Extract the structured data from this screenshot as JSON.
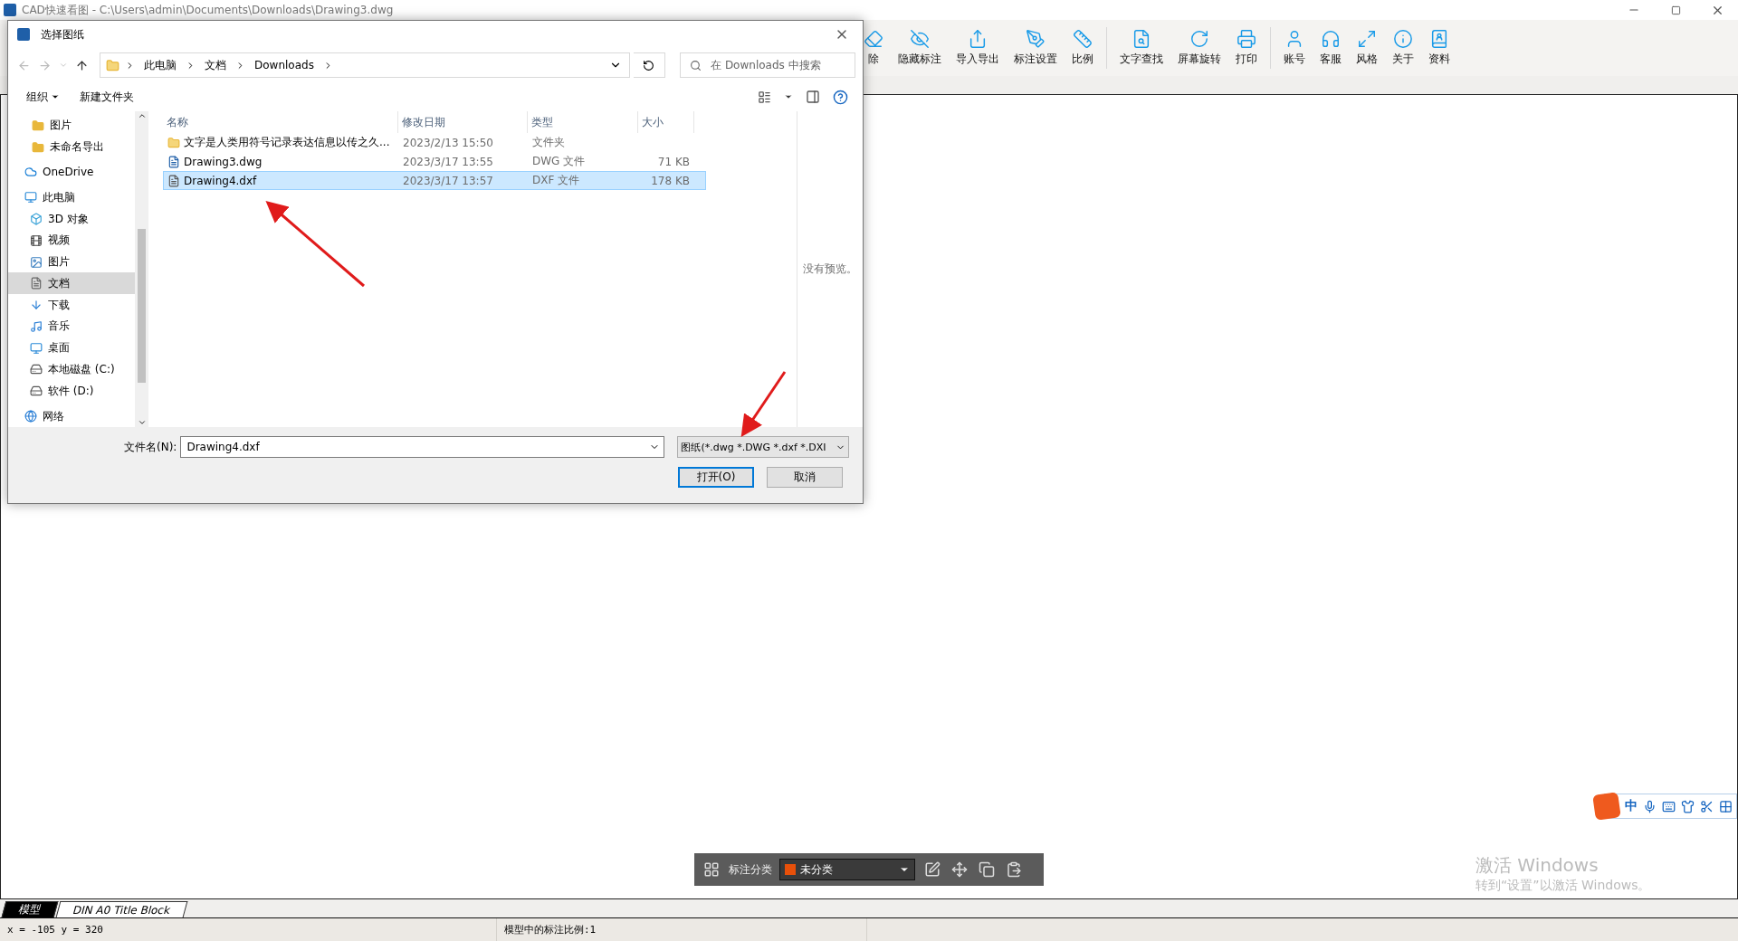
{
  "app": {
    "title": "CAD快速看图 - C:\\Users\\admin\\Documents\\Downloads\\Drawing3.dwg"
  },
  "toolbar": {
    "groups": [
      [
        {
          "label": "除",
          "kind": "erase"
        },
        {
          "label": "隐藏标注",
          "kind": "hide"
        },
        {
          "label": "导入导出",
          "kind": "export"
        },
        {
          "label": "标注设置",
          "kind": "pen"
        },
        {
          "label": "比例",
          "kind": "ruler"
        }
      ],
      [
        {
          "label": "文字查找",
          "kind": "find"
        },
        {
          "label": "屏幕旋转",
          "kind": "rotate"
        },
        {
          "label": "打印",
          "kind": "print"
        }
      ],
      [
        {
          "label": "账号",
          "kind": "user"
        },
        {
          "label": "客服",
          "kind": "headset"
        },
        {
          "label": "风格",
          "kind": "style"
        },
        {
          "label": "关于",
          "kind": "info"
        },
        {
          "label": "资料",
          "kind": "book"
        }
      ]
    ]
  },
  "dialog": {
    "title": "选择图纸",
    "breadcrumb": [
      "此电脑",
      "文档",
      "Downloads"
    ],
    "search": {
      "placeholder": "在 Downloads 中搜索"
    },
    "commands": [
      {
        "label": "组织",
        "kind": "menu"
      },
      {
        "label": "新建文件夹",
        "kind": "plain"
      }
    ],
    "sidebar": [
      {
        "label": "图片",
        "kind": "folder",
        "selected": false
      },
      {
        "label": "未命名导出",
        "kind": "folder",
        "selected": false
      },
      {
        "label": "OneDrive",
        "kind": "cloud",
        "selected": false
      },
      {
        "label": "此电脑",
        "kind": "pc",
        "selected": false,
        "children": [
          {
            "label": "3D 对象",
            "kind": "cube",
            "selected": false
          },
          {
            "label": "视频",
            "kind": "video",
            "selected": false
          },
          {
            "label": "图片",
            "kind": "picture",
            "selected": false
          },
          {
            "label": "文档",
            "kind": "doc",
            "selected": true
          },
          {
            "label": "下载",
            "kind": "download",
            "selected": false
          },
          {
            "label": "音乐",
            "kind": "music",
            "selected": false
          },
          {
            "label": "桌面",
            "kind": "desktop",
            "selected": false
          },
          {
            "label": "本地磁盘 (C:)",
            "kind": "drive",
            "selected": false
          },
          {
            "label": "软件 (D:)",
            "kind": "drive",
            "selected": false
          }
        ]
      },
      {
        "label": "网络",
        "kind": "network",
        "selected": false
      }
    ],
    "columns": [
      "名称",
      "修改日期",
      "类型",
      "大小"
    ],
    "rows": [
      {
        "name": "文字是人类用符号记录表达信息以传之久...",
        "date": "2023/2/13 15:50",
        "type": "文件夹",
        "size": "",
        "kind": "folder",
        "selected": false
      },
      {
        "name": "Drawing3.dwg",
        "date": "2023/3/17 13:55",
        "type": "DWG 文件",
        "size": "71 KB",
        "kind": "cad",
        "selected": false
      },
      {
        "name": "Drawing4.dxf",
        "date": "2023/3/17 13:57",
        "type": "DXF 文件",
        "size": "178 KB",
        "kind": "dxf",
        "selected": true
      }
    ],
    "preview": "没有预览。",
    "filename": {
      "label": "文件名(N):",
      "value": "Drawing4.dxf"
    },
    "filter": "图纸(*.dwg *.DWG *.dxf *.DXI",
    "buttons": [
      {
        "label": "打开(O)",
        "kind": "default"
      },
      {
        "label": "取消",
        "kind": "normal"
      }
    ]
  },
  "annotation_bar": {
    "label": "标注分类",
    "category": "未分类",
    "color": "#e8500a"
  },
  "ime": {
    "mode": "中"
  },
  "activation": {
    "title": "激活 Windows",
    "hint": "转到“设置”以激活 Windows。"
  },
  "tabs": [
    {
      "label": "模型",
      "selected": true
    },
    {
      "label": "DIN A0 Title Block",
      "selected": false
    }
  ],
  "status": {
    "coords": "x = -105 y = 320",
    "scale": "模型中的标注比例:1"
  }
}
